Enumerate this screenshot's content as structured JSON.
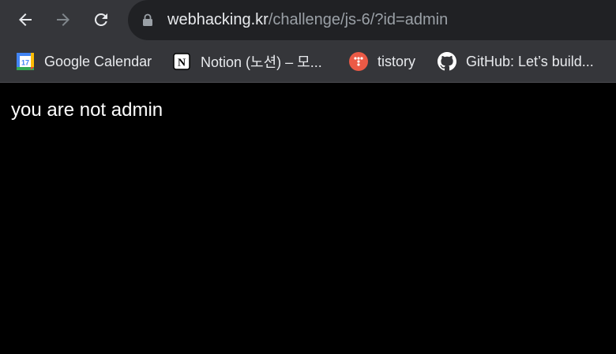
{
  "toolbar": {
    "back_icon": "back-arrow-icon",
    "forward_icon": "forward-arrow-icon",
    "reload_icon": "reload-icon"
  },
  "omnibox": {
    "lock_icon": "lock-icon",
    "url_host": "webhacking.kr",
    "url_path": "/challenge/js-6/?id=admin"
  },
  "bookmarks": [
    {
      "label": "Google Calendar",
      "icon": "google-calendar-icon"
    },
    {
      "label": "Notion (노션) – 모...",
      "icon": "notion-icon"
    },
    {
      "label": "tistory",
      "icon": "tistory-icon"
    },
    {
      "label": "GitHub: Let’s build...",
      "icon": "github-icon"
    }
  ],
  "page": {
    "message": "you are not admin"
  },
  "colors": {
    "toolbar_bg": "#35363a",
    "omnibox_bg": "#202124",
    "page_bg": "#000000",
    "tistory": "#eb5a46"
  }
}
